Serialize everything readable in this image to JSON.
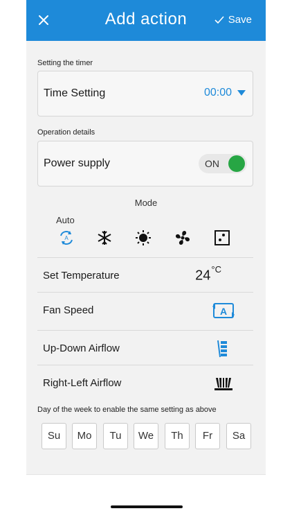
{
  "header": {
    "title": "Add action",
    "save_label": "Save"
  },
  "timer": {
    "section_label": "Setting the timer",
    "label": "Time Setting",
    "value": "00:00"
  },
  "operation": {
    "section_label": "Operation details",
    "power_label": "Power supply",
    "power_state": "ON"
  },
  "mode": {
    "title": "Mode",
    "selected_label": "Auto",
    "icons": [
      "auto-mode-icon",
      "cool-mode-icon",
      "heat-mode-icon",
      "fan-mode-icon",
      "dry-mode-icon"
    ]
  },
  "settings": {
    "temperature_label": "Set Temperature",
    "temperature_value": "24",
    "temperature_unit": "°C",
    "fan_label": "Fan Speed",
    "updown_label": "Up-Down Airflow",
    "rightleft_label": "Right-Left Airflow"
  },
  "days": {
    "label": "Day of the week to enable the same setting as above",
    "items": [
      "Su",
      "Mo",
      "Tu",
      "We",
      "Th",
      "Fr",
      "Sa"
    ]
  },
  "colors": {
    "accent": "#1e8ad9",
    "toggle_on": "#27a644"
  }
}
